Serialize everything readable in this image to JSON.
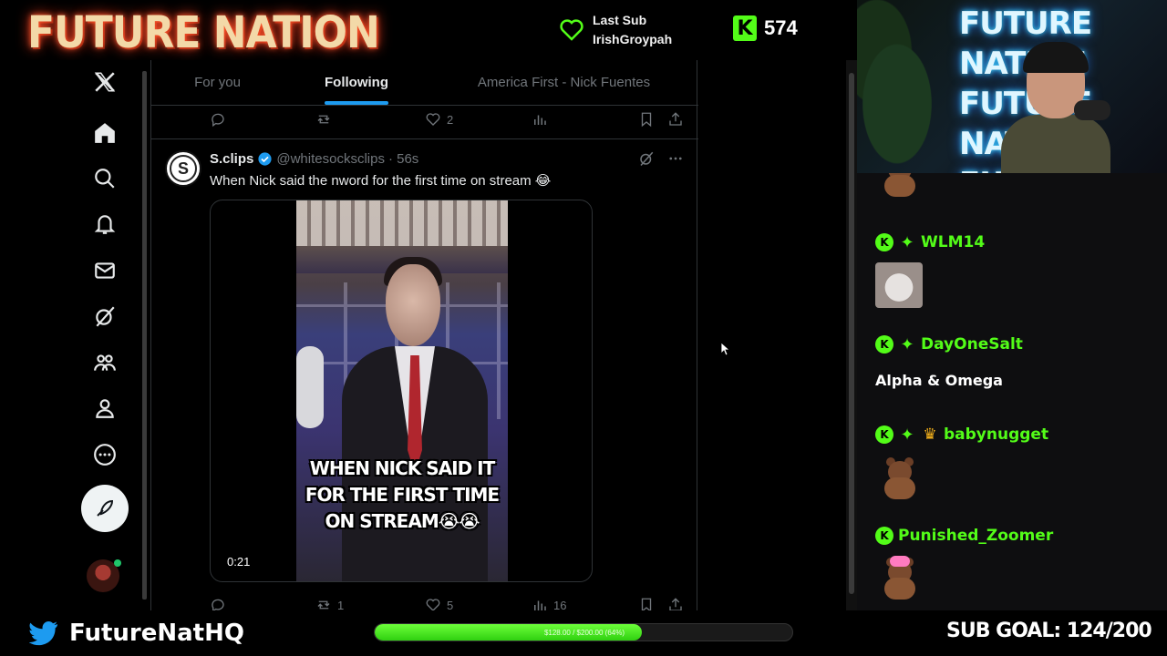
{
  "overlay": {
    "brand": "FUTURE NATION",
    "last_sub_label": "Last Sub",
    "last_sub_name": "IrishGroypah",
    "kick_logo": "K",
    "follower_count": "574",
    "twitter_handle": "FutureNatHQ",
    "goal_bar_text": "$128.00 / $200.00 (64%)",
    "goal_fraction": 0.64,
    "sub_goal": "SUB GOAL: 124/200",
    "accent_green": "#53fc18"
  },
  "x": {
    "tabs": [
      {
        "label": "For you",
        "active": false
      },
      {
        "label": "Following",
        "active": true
      },
      {
        "label": "America First - Nick Fuentes",
        "active": false
      }
    ],
    "nav_icons": [
      "x-logo-icon",
      "home-icon",
      "search-icon",
      "bell-icon",
      "mail-icon",
      "grok-icon",
      "communities-icon",
      "profile-icon",
      "more-icon",
      "compose-icon"
    ],
    "prev_post_actions": {
      "replies": "",
      "reposts": "",
      "likes": "2",
      "views": ""
    },
    "post": {
      "avatar_letter": "S",
      "name": "S.clips",
      "handle": "@whitesocksclips",
      "time": "· 56s",
      "text": "When Nick said the nword for the first time on stream 😂",
      "video_caption": "WHEN NICK SAID IT FOR THE FIRST TIME ON STREAM😭😭",
      "video_duration": "0:21",
      "actions": {
        "replies": "",
        "reposts": "1",
        "likes": "5",
        "views": "16"
      }
    },
    "accent_blue": "#1d9bf0"
  },
  "webcam": {
    "sign_text": "FUTURE NATION FUTURE NATION FUTURE NATION"
  },
  "chat": {
    "messages": [
      {
        "user": "",
        "badges": [],
        "emote": "bear-emote"
      },
      {
        "user": "WLM14",
        "badges": [
          "kick",
          "diamond"
        ],
        "emote": "rat-emote"
      },
      {
        "user": "DayOneSalt",
        "badges": [
          "kick",
          "diamond"
        ],
        "text": "Alpha & Omega"
      },
      {
        "user": "babynugget",
        "badges": [
          "kick",
          "diamond",
          "crown"
        ],
        "emote": "bear-emote"
      },
      {
        "user": "Punished_Zoomer",
        "badges": [
          "kick"
        ],
        "emote": "bear-bow-emote"
      }
    ]
  }
}
